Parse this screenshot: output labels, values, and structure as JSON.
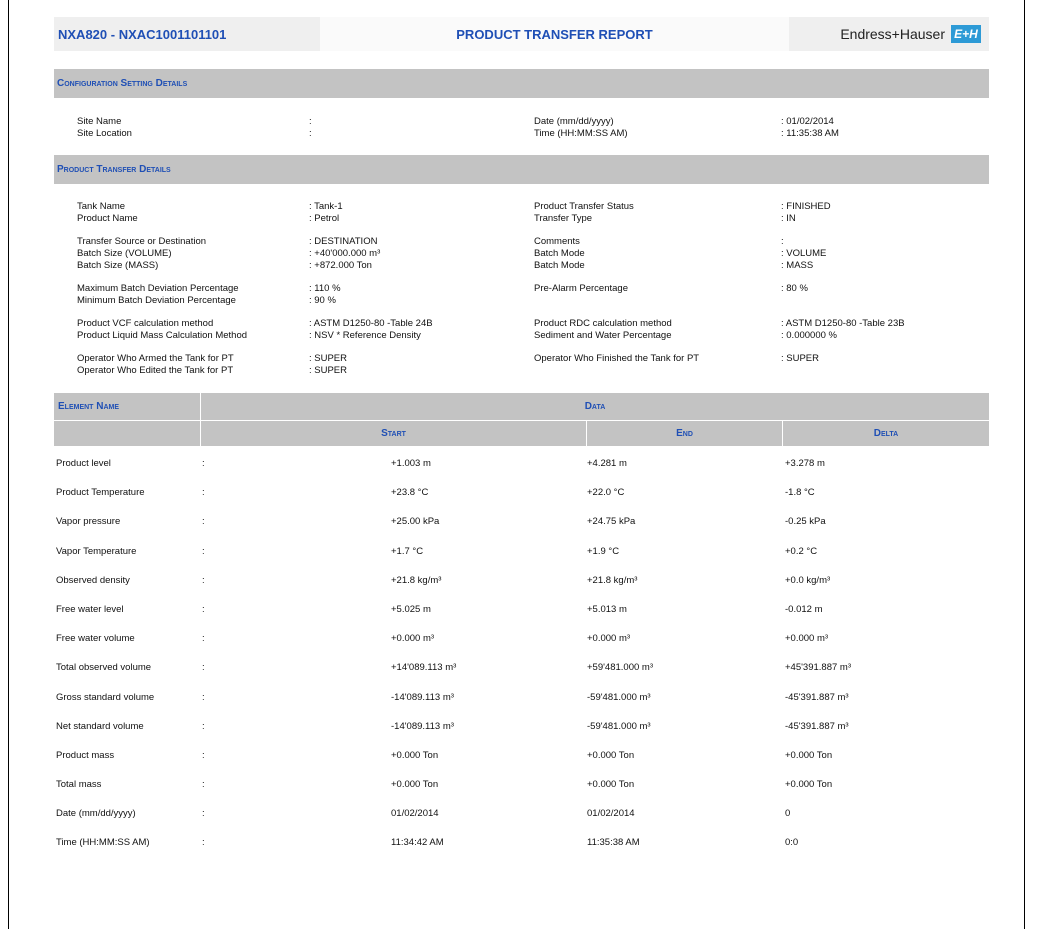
{
  "header": {
    "doc_id": "NXA820 - NXAC1001101101",
    "title": "PRODUCT TRANSFER REPORT",
    "brand": "Endress+Hauser",
    "logo_text": "E+H"
  },
  "config": {
    "section_title": "Configuration Setting Details",
    "rows": [
      {
        "k1": "Site Name",
        "v1": ":",
        "k2": "Date (mm/dd/yyyy)",
        "v2": ":  01/02/2014"
      },
      {
        "k1": "Site Location",
        "v1": ":",
        "k2": "Time (HH:MM:SS AM)",
        "v2": ":  11:35:38 AM"
      }
    ]
  },
  "transfer": {
    "section_title": "Product Transfer Details",
    "groups": [
      [
        {
          "k1": "Tank Name",
          "v1": ": Tank-1",
          "k2": "Product Transfer Status",
          "v2": ":  FINISHED"
        },
        {
          "k1": "Product Name",
          "v1": ": Petrol",
          "k2": "Transfer Type",
          "v2": ":  IN"
        }
      ],
      [
        {
          "k1": "Transfer Source or Destination",
          "v1": ": DESTINATION",
          "k2": "Comments",
          "v2": ":"
        },
        {
          "k1": "Batch Size (VOLUME)",
          "v1": ": +40'000.000  m³",
          "k2": "Batch Mode",
          "v2": ":  VOLUME"
        },
        {
          "k1": "Batch Size (MASS)",
          "v1": ": +872.000  Ton",
          "k2": "Batch Mode",
          "v2": ":  MASS"
        }
      ],
      [
        {
          "k1": "Maximum Batch Deviation Percentage",
          "v1": ": 110 %",
          "k2": "Pre-Alarm Percentage",
          "v2": ":  80 %"
        },
        {
          "k1": "Minimum Batch Deviation Percentage",
          "v1": ": 90 %",
          "k2": "",
          "v2": ""
        }
      ],
      [
        {
          "k1": "Product VCF calculation method",
          "v1": ": ASTM D1250-80 -Table 24B",
          "k2": "Product RDC calculation method",
          "v2": ":  ASTM D1250-80 -Table 23B"
        },
        {
          "k1": "Product Liquid Mass Calculation Method",
          "v1": ": NSV * Reference Density",
          "k2": "Sediment and Water Percentage",
          "v2": ":  0.000000 %"
        }
      ],
      [
        {
          "k1": "Operator Who Armed the Tank for PT",
          "v1": ": SUPER",
          "k2": "Operator Who Finished the Tank for PT",
          "v2": ":  SUPER"
        },
        {
          "k1": "Operator Who Edited the Tank for PT",
          "v1": ": SUPER",
          "k2": "",
          "v2": ""
        }
      ]
    ]
  },
  "table": {
    "col_element": "Element Name",
    "col_data": "Data",
    "col_start": "Start",
    "col_end": "End",
    "col_delta": "Delta",
    "rows": [
      {
        "name": "Product level",
        "sep": ":",
        "start": "+1.003  m",
        "end": "+4.281  m",
        "delta": "+3.278  m"
      },
      {
        "name": "Product Temperature",
        "sep": ":",
        "start": "+23.8  °C",
        "end": "+22.0  °C",
        "delta": "-1.8  °C"
      },
      {
        "name": "Vapor pressure",
        "sep": ":",
        "start": "+25.00  kPa",
        "end": "+24.75  kPa",
        "delta": "-0.25  kPa"
      },
      {
        "name": "Vapor Temperature",
        "sep": ":",
        "start": "+1.7  °C",
        "end": "+1.9  °C",
        "delta": "+0.2  °C"
      },
      {
        "name": "Observed density",
        "sep": ":",
        "start": "+21.8  kg/m³",
        "end": "+21.8  kg/m³",
        "delta": "+0.0  kg/m³"
      },
      {
        "name": "Free water level",
        "sep": ":",
        "start": "+5.025  m",
        "end": "+5.013  m",
        "delta": "-0.012  m"
      },
      {
        "name": "Free water volume",
        "sep": ":",
        "start": "+0.000  m³",
        "end": "+0.000  m³",
        "delta": "+0.000  m³"
      },
      {
        "name": "Total observed volume",
        "sep": ":",
        "start": "+14'089.113  m³",
        "end": "+59'481.000  m³",
        "delta": "+45'391.887  m³"
      },
      {
        "name": "Gross standard volume",
        "sep": ":",
        "start": "-14'089.113  m³",
        "end": "-59'481.000  m³",
        "delta": "-45'391.887  m³"
      },
      {
        "name": "Net standard volume",
        "sep": ":",
        "start": "-14'089.113  m³",
        "end": "-59'481.000  m³",
        "delta": "-45'391.887  m³"
      },
      {
        "name": "Product mass",
        "sep": ":",
        "start": "+0.000  Ton",
        "end": "+0.000  Ton",
        "delta": "+0.000  Ton"
      },
      {
        "name": "Total mass",
        "sep": ":",
        "start": "+0.000  Ton",
        "end": "+0.000  Ton",
        "delta": "+0.000  Ton"
      },
      {
        "name": "Date (mm/dd/yyyy)",
        "sep": ":",
        "start": "01/02/2014",
        "end": "01/02/2014",
        "delta": "0"
      },
      {
        "name": "Time (HH:MM:SS AM)",
        "sep": ":",
        "start": "11:34:42 AM",
        "end": "11:35:38 AM",
        "delta": "0:0"
      }
    ]
  },
  "colors": {
    "accent_blue": "#1f4fb5",
    "bar_gray": "#c3c3c3",
    "logo_blue": "#2d9ad6"
  }
}
